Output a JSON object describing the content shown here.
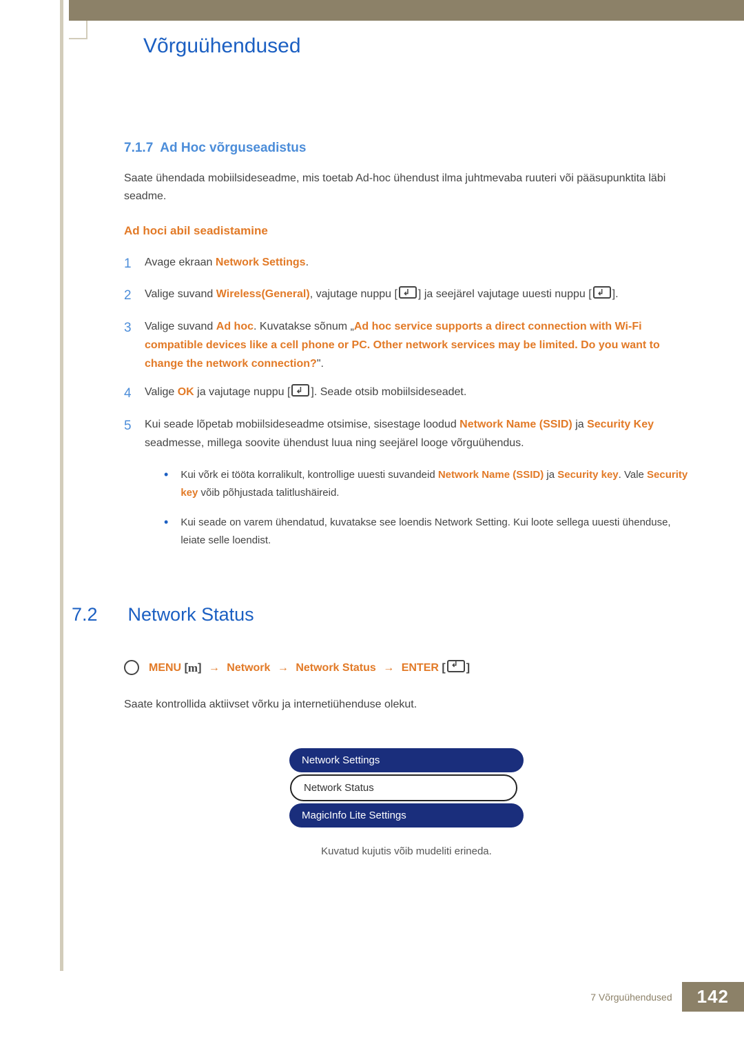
{
  "chapter_title": "Võrguühendused",
  "subsection_number": "7.1.7",
  "subsection_title": "Ad Hoc võrguseadistus",
  "intro_paragraph": "Saate ühendada mobiilsideseadme, mis toetab Ad-hoc ühendust ilma juhtmevaba ruuteri või pääsupunktita läbi seadme.",
  "subhead": "Ad hoci abil seadistamine",
  "steps": [
    {
      "n": "1",
      "pre": "Avage ekraan ",
      "b1": "Network Settings",
      "post": "."
    },
    {
      "n": "2",
      "pre": "Valige suvand ",
      "b1": "Wireless(General)",
      "mid": ", vajutage nuppu [",
      "icon1": true,
      "mid2": "] ja seejärel vajutage uuesti nuppu [",
      "icon2": true,
      "post": "]."
    },
    {
      "n": "3",
      "pre": "Valige suvand ",
      "b1": "Ad hoc",
      "mid": ". Kuvatakse sõnum „",
      "b2": "Ad hoc service supports a direct connection with Wi-Fi compatible devices like a cell phone or PC. Other network services may be limited. Do you want to change the network connection?",
      "post": "\"."
    },
    {
      "n": "4",
      "pre": "Valige ",
      "b1": "OK",
      "mid": " ja vajutage nuppu [",
      "icon1": true,
      "post": "]. Seade otsib mobiilsideseadet."
    },
    {
      "n": "5",
      "pre": "Kui seade lõpetab mobiilsideseadme otsimise, sisestage loodud ",
      "b1": "Network Name (SSID)",
      "mid": " ja ",
      "b2": "Security Key",
      "post": " seadmesse, millega soovite ühendust luua ning seejärel looge võrguühendus."
    }
  ],
  "notes": [
    {
      "pre": "Kui võrk ei tööta korralikult, kontrollige uuesti suvandeid ",
      "b1": "Network Name (SSID)",
      "mid": " ja ",
      "b2": "Security key",
      "mid2": ". Vale ",
      "b3": "Security key",
      "post": " võib põhjustada talitlushäireid."
    },
    {
      "plain": "Kui seade on varem ühendatud, kuvatakse see loendis Network Setting. Kui loote sellega uuesti ühenduse, leiate selle loendist."
    }
  ],
  "section_number": "7.2",
  "section_title": "Network Status",
  "breadcrumb": {
    "menu": "MENU",
    "b_open": "[",
    "m_icon": "m",
    "b_close": "]",
    "arrow": "→",
    "network": "Network",
    "network_status": "Network Status",
    "enter": "ENTER",
    "enter_icon_open": "[",
    "enter_icon_close": "]"
  },
  "status_paragraph": "Saate kontrollida aktiivset võrku ja internetiühenduse olekut.",
  "menu_items": [
    {
      "label": "Network Settings",
      "style": "navy"
    },
    {
      "label": "Network Status",
      "style": "sel"
    },
    {
      "label": "MagicInfo Lite Settings",
      "style": "navy"
    }
  ],
  "caption": "Kuvatud kujutis võib mudeliti erineda.",
  "footer_text": "7 Võrguühendused",
  "page_number": "142"
}
